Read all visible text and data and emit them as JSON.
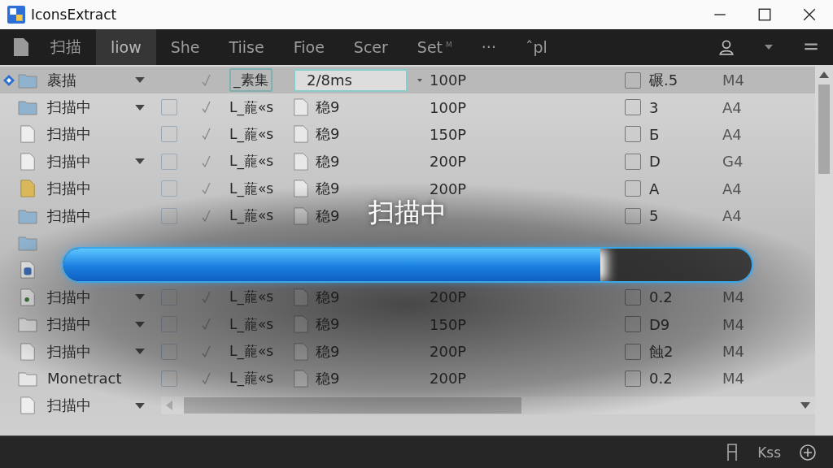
{
  "window": {
    "title": "IconsExtract"
  },
  "toolbar": {
    "tabs": [
      {
        "label": "扫描",
        "selected": false
      },
      {
        "label": "liow",
        "selected": true
      },
      {
        "label": "She",
        "selected": false
      },
      {
        "label": "Tiise",
        "selected": false
      },
      {
        "label": "Fioe",
        "selected": false
      },
      {
        "label": "Scer",
        "selected": false
      },
      {
        "label": "Set",
        "selected": false,
        "badge": "M"
      },
      {
        "label": "···",
        "selected": false
      },
      {
        "label": "ˆpl",
        "selected": false
      }
    ]
  },
  "table": {
    "rows": [
      {
        "selected": true,
        "pinned": true,
        "kind": "folder",
        "name": "裹描",
        "caret": true,
        "tick": true,
        "col_3": "_素集",
        "col_4": "2/8ms",
        "col_5": "100P",
        "col_6": "碾.5",
        "col_6_checked": false,
        "col_7": "M4"
      },
      {
        "selected": false,
        "pinned": false,
        "kind": "folder",
        "name": "扫描中",
        "caret": true,
        "checked": false,
        "tick": true,
        "col_3": "L_蘢«s",
        "col_4": "稳9",
        "col_5": "100P",
        "col_6": "3",
        "col_6_checked": false,
        "col_7": "A4"
      },
      {
        "selected": false,
        "pinned": false,
        "kind": "file",
        "name": "扫描中",
        "caret": false,
        "checked": false,
        "tick": true,
        "col_3": "L_蘢«s",
        "col_4": "稳9",
        "col_5": "150P",
        "col_6": "Б",
        "col_6_checked": false,
        "col_7": "A4"
      },
      {
        "selected": false,
        "pinned": false,
        "kind": "file",
        "name": "扫描中",
        "caret": true,
        "checked": false,
        "tick": true,
        "col_3": "L_蘢«s",
        "col_4": "稳9",
        "col_5": "200P",
        "col_6": "D",
        "col_6_checked": false,
        "col_7": "G4"
      },
      {
        "selected": false,
        "pinned": false,
        "kind": "note",
        "name": "扫描中",
        "caret": false,
        "checked": false,
        "tick": true,
        "col_3": "L_蘢«s",
        "col_4": "稳9",
        "col_5": "200P",
        "col_6": "A",
        "col_6_checked": false,
        "col_7": "A4"
      },
      {
        "selected": false,
        "pinned": false,
        "kind": "folder",
        "name": "扫描中",
        "caret": false,
        "checked": false,
        "tick": true,
        "col_3": "L_蘢«s",
        "col_4": "稳9",
        "col_6": "5",
        "col_6_checked": false,
        "col_7": "A4"
      },
      {
        "kind": "folder"
      },
      {
        "kind": "app"
      },
      {
        "selected": false,
        "pinned": false,
        "kind": "dotfile",
        "name": "扫描中",
        "caret": true,
        "checked": false,
        "tick": true,
        "col_3": "L_蘢«s",
        "col_4": "稳9",
        "col_5": "200P",
        "col_6": "0.2",
        "col_6_checked": false,
        "col_7": "M4"
      },
      {
        "selected": false,
        "pinned": false,
        "kind": "folderlight",
        "name": "扫描中",
        "caret": true,
        "checked": false,
        "tick": true,
        "col_3": "L_蘢«s",
        "col_4": "稳9",
        "col_5": "150P",
        "col_6": "D9",
        "col_6_checked": false,
        "col_7": "M4"
      },
      {
        "selected": false,
        "pinned": false,
        "kind": "file",
        "name": "扫描中",
        "caret": true,
        "checked": false,
        "tick": true,
        "col_3": "L_蘢«s",
        "col_4": "稳9",
        "col_5": "200P",
        "col_6": "蝕2",
        "col_6_checked": false,
        "col_7": "M4"
      },
      {
        "selected": false,
        "pinned": false,
        "kind": "folderlight",
        "name": "Monetract",
        "caret": false,
        "checked": false,
        "tick": true,
        "col_3": "L_蘢«s",
        "col_4": "稳9",
        "col_5": "200P",
        "col_6": "0.2",
        "col_6_checked": false,
        "col_7": "M4"
      }
    ],
    "footer_row": {
      "kind": "file",
      "name": "扫描中",
      "caret": true
    }
  },
  "status_bar": {
    "label": "Kss"
  },
  "progress": {
    "label": "扫描中",
    "level": 0.78
  }
}
